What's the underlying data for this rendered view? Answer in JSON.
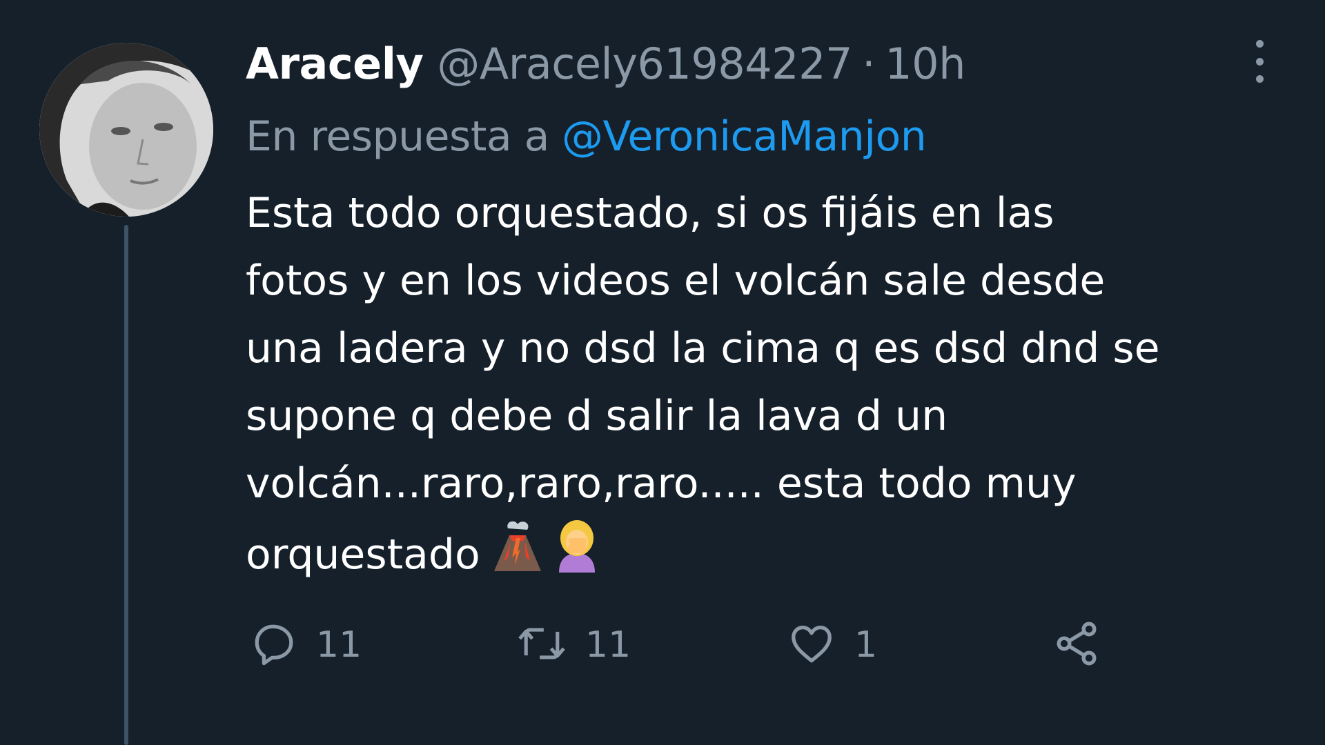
{
  "tweet": {
    "display_name": "Aracely",
    "handle": "@Aracely61984227",
    "separator": "·",
    "time": "10h",
    "reply_prefix": "En respuesta a",
    "reply_to": "@VeronicaManjon",
    "body_lines": [
      "Esta todo orquestado, si os fijáis en las",
      "fotos y en los videos el volcán sale desde",
      "una ladera y no dsd la cima q es dsd dnd se",
      "supone q debe d salir la lava d un",
      "volcán...raro,raro,raro..... esta todo muy",
      "orquestado"
    ],
    "emojis": [
      "volcano-icon",
      "woman-facepalming-icon"
    ]
  },
  "actions": {
    "reply_count": "11",
    "retweet_count": "11",
    "like_count": "1"
  },
  "colors": {
    "background": "#15202b",
    "muted": "#8b98a5",
    "link": "#1d9bf0",
    "thread_line": "#3d5466"
  }
}
